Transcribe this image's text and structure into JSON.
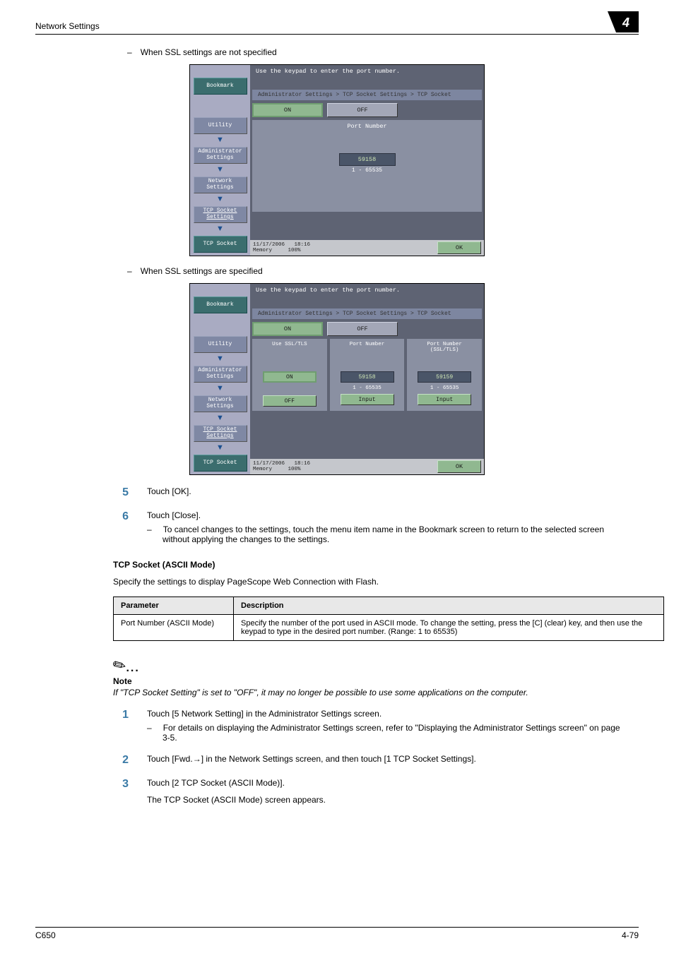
{
  "header": {
    "title": "Network Settings",
    "chapter": "4"
  },
  "intro_bullets": [
    "When SSL settings are not specified",
    "When SSL settings are specified"
  ],
  "screen_common": {
    "title": "Use the keypad to enter the port number.",
    "breadcrumb": "Administrator Settings > TCP Socket Settings > TCP Socket",
    "nav": {
      "bookmark": "Bookmark",
      "utility": "Utility",
      "admin": "Administrator\nSettings",
      "network": "Network\nSettings",
      "tcp_sockets": "TCP Socket\nSettings",
      "tcp_socket": "TCP Socket"
    },
    "on": "ON",
    "off": "OFF",
    "ok": "OK",
    "status": {
      "date": "11/17/2006",
      "time": "18:16",
      "mem_label": "Memory",
      "mem_val": "100%"
    }
  },
  "screen1": {
    "port_label": "Port Number",
    "port_value": "59158",
    "port_range": "1  -  65535"
  },
  "screen2": {
    "col1": {
      "title": "Use SSL/TLS",
      "on": "ON",
      "off": "OFF"
    },
    "col2": {
      "title": "Port Number",
      "value": "59158",
      "range": "1  -  65535",
      "input": "Input"
    },
    "col3": {
      "title": "Port Number\n(SSL/TLS)",
      "value": "59159",
      "range": "1  -  65535",
      "input": "Input"
    }
  },
  "steps_a": [
    {
      "n": "5",
      "text": "Touch [OK]."
    },
    {
      "n": "6",
      "text": "Touch [Close].",
      "sub": "To cancel changes to the settings, touch the menu item name in the Bookmark screen to return to the selected screen without applying the changes to the settings."
    }
  ],
  "section2": {
    "heading": "TCP Socket (ASCII Mode)",
    "intro": "Specify the settings to display PageScope Web Connection with Flash."
  },
  "table": {
    "h1": "Parameter",
    "h2": "Description",
    "r1c1": "Port Number (ASCII Mode)",
    "r1c2": "Specify the number of the port used in ASCII mode. To change the setting, press the [C] (clear) key, and then use the keypad to type in the desired port number. (Range: 1 to 65535)"
  },
  "note": {
    "label": "Note",
    "text": "If \"TCP Socket Setting\" is set to \"OFF\", it may no longer be possible to use some applications on the computer."
  },
  "steps_b": [
    {
      "n": "1",
      "text": "Touch [5 Network Setting] in the Administrator Settings screen.",
      "sub": "For details on displaying the Administrator Settings screen, refer to \"Displaying the Administrator Settings screen\" on page 3-5."
    },
    {
      "n": "2",
      "text": "Touch [Fwd.→] in the Network Settings screen, and then touch [1 TCP Socket Settings]."
    },
    {
      "n": "3",
      "text": "Touch [2 TCP Socket (ASCII Mode)].",
      "extra": "The TCP Socket (ASCII Mode) screen appears."
    }
  ],
  "footer": {
    "left": "C650",
    "right": "4-79"
  }
}
